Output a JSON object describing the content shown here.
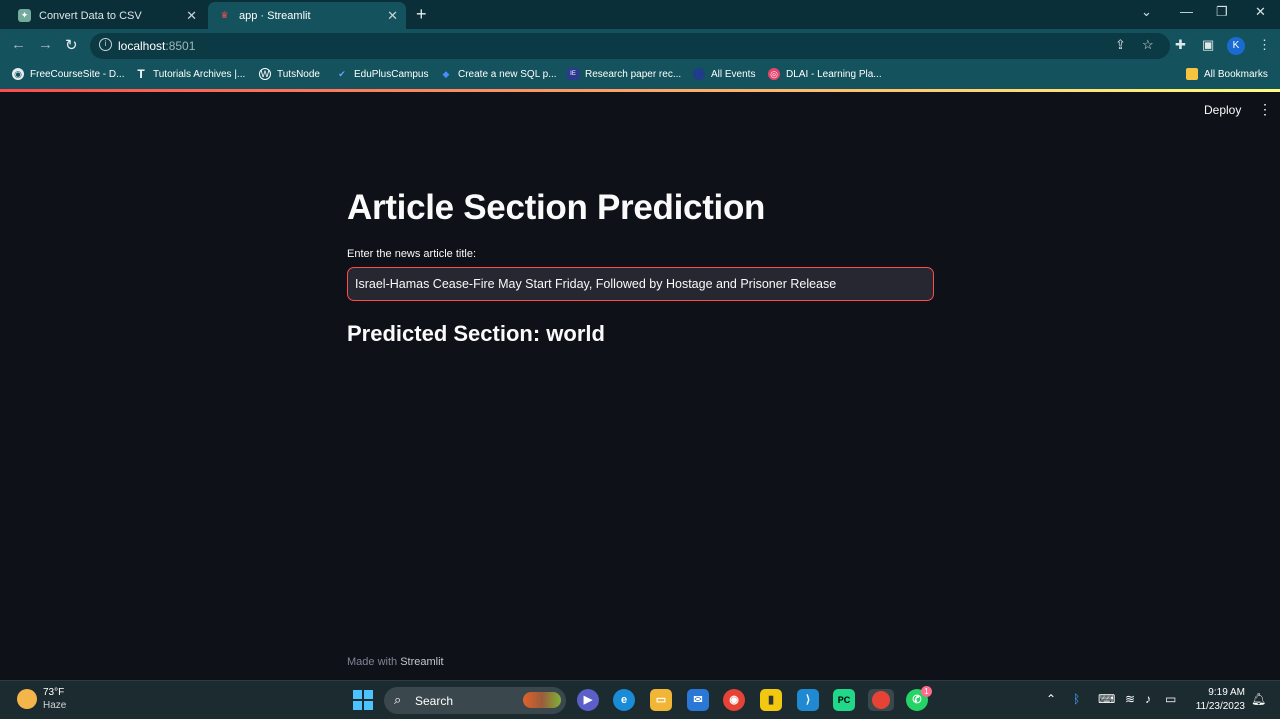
{
  "browser": {
    "tabs": [
      {
        "title": "Convert Data to CSV",
        "active": false
      },
      {
        "title": "app · Streamlit",
        "active": true
      }
    ],
    "url_host": "localhost",
    "url_port": ":8501",
    "profile_initial": "K",
    "bookmarks": [
      {
        "label": "FreeCourseSite - D..."
      },
      {
        "label": "Tutorials Archives |..."
      },
      {
        "label": "TutsNode"
      },
      {
        "label": "EduPlusCampus"
      },
      {
        "label": "Create a new SQL p..."
      },
      {
        "label": "Research paper rec..."
      },
      {
        "label": "All Events"
      },
      {
        "label": "DLAI - Learning Pla..."
      }
    ],
    "all_bookmarks": "All Bookmarks"
  },
  "app": {
    "deploy_label": "Deploy",
    "title": "Article Section Prediction",
    "input_label": "Enter the news article title:",
    "input_value": "Israel-Hamas Cease-Fire May Start Friday, Followed by Hostage and Prisoner Release",
    "prediction": "Predicted Section: world",
    "footer_prefix": "Made with ",
    "footer_brand": "Streamlit",
    "accent_color": "#ff4b4b"
  },
  "taskbar": {
    "temperature": "73°F",
    "condition": "Haze",
    "search_label": "Search",
    "whatsapp_badge": "1",
    "time": "9:19 AM",
    "date": "11/23/2023"
  }
}
